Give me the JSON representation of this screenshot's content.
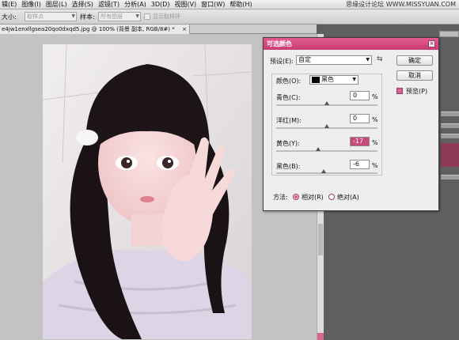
{
  "menubar": {
    "items": [
      "辑(E)",
      "图像(I)",
      "图层(L)",
      "选择(S)",
      "滤镜(T)",
      "分析(A)",
      "3D(D)",
      "视图(V)",
      "窗口(W)",
      "帮助(H)"
    ],
    "watermark": "思缘设计论坛 WWW.MISSYUAN.COM"
  },
  "options": {
    "size_label": "大小:",
    "size_value": "取样点",
    "sample_label": "样本:",
    "sample_value": "所有图层",
    "show_ring_label": "显示取样环"
  },
  "document": {
    "tab_title": "e4jw1enxllgsea20qo0dxqd5.jpg @ 100% (背景 副本, RGB/8#) *",
    "close_glyph": "×"
  },
  "dialog": {
    "title": "可选颜色",
    "close_glyph": "×",
    "preset_label": "预设(E):",
    "preset_value": "自定",
    "preset_icon": "preset-options-icon",
    "ok_label": "确定",
    "cancel_label": "取消",
    "preview_label": "预览(P)",
    "preview_checked": true,
    "colors_label": "颜色(O):",
    "colors_value": "黑色",
    "colors_swatch": "#000000",
    "sliders": [
      {
        "label": "青色(C):",
        "value": "0",
        "unit": "%",
        "level": 0
      },
      {
        "label": "洋红(M):",
        "value": "0",
        "unit": "%",
        "level": 0
      },
      {
        "label": "黄色(Y):",
        "value": "-17",
        "unit": "%",
        "level": -17
      },
      {
        "label": "黑色(B):",
        "value": "-6",
        "unit": "%",
        "level": -6
      }
    ],
    "method_label": "方法:",
    "method_relative": "相对(R)",
    "method_absolute": "绝对(A)",
    "method_selected": "relative"
  },
  "colors": {
    "accent": "#d14b86",
    "dialog_title": "#c83d73",
    "canvas_bg": "#c3c3c3"
  }
}
